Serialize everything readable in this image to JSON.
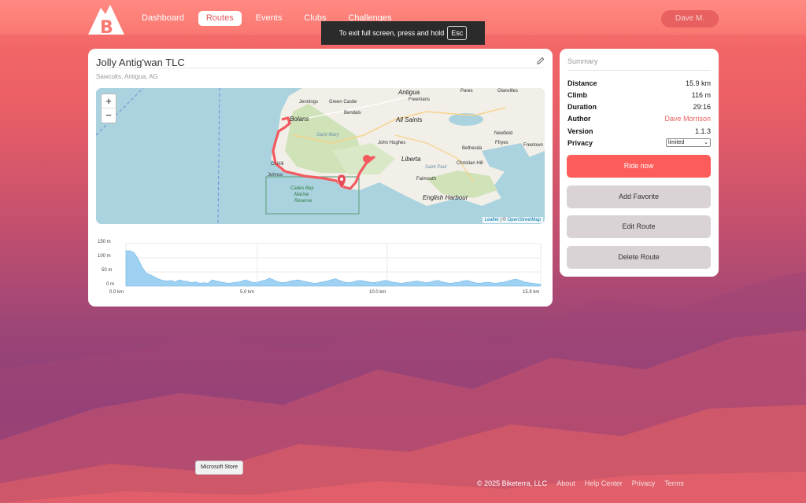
{
  "nav": {
    "items": [
      {
        "label": "Dashboard",
        "active": false
      },
      {
        "label": "Routes",
        "active": true
      },
      {
        "label": "Events",
        "active": false
      },
      {
        "label": "Clubs",
        "active": false
      },
      {
        "label": "Challenges",
        "active": false
      }
    ],
    "user": "Dave M."
  },
  "fullscreen_toast": {
    "text": "To exit full screen, press and hold",
    "key": "Esc"
  },
  "route": {
    "title": "Jolly Antig'wan TLC",
    "location": "Sawcolts, Antigua, AG",
    "edit_icon": "pencil-icon"
  },
  "map": {
    "zoom_in": "+",
    "zoom_out": "−",
    "labels": {
      "antigua": "Antigua",
      "all_saints": "All Saints",
      "liberta": "Liberta",
      "bolans": "Bolans",
      "jennings": "Jennings",
      "green_castle": "Green Castle",
      "bendals": "Bendals",
      "freemans": "Freemans",
      "parés": "Pares",
      "glanvilles": "Glanvilles",
      "newfield": "Newfield",
      "freetown": "Freetown",
      "ffryes": "Ffryes",
      "bethesda": "Bethesda",
      "christian_hill": "Christian Hill",
      "john_hughes": "John Hughes",
      "falmouth": "Falmouth",
      "english_harbour": "English Harbour",
      "saint_mary": "Saint Mary",
      "saint_paul": "Saint Paul",
      "cades_bay": "Cades Bay",
      "marine": "Marine",
      "reserve": "Reserve",
      "johnsons": "Johnso",
      "crab_hill": "Cr Hill"
    },
    "attribution": {
      "leaflet": "Leaflet",
      "sep": "| ©",
      "osm": "OpenStreetMap"
    }
  },
  "elevation": {
    "y_ticks": [
      "150 m",
      "100 m",
      "50 m",
      "0 m"
    ],
    "x_ticks": [
      "0.0 km",
      "5.0 km",
      "10.0 km",
      "15.9 km"
    ],
    "profile_m": [
      125,
      125,
      118,
      95,
      65,
      45,
      40,
      32,
      25,
      20,
      18,
      20,
      15,
      22,
      18,
      16,
      12,
      15,
      10,
      12,
      10,
      22,
      18,
      15,
      12,
      10,
      12,
      14,
      16,
      22,
      18,
      12,
      14,
      18,
      22,
      28,
      22,
      15,
      12,
      14,
      18,
      20,
      22,
      18,
      15,
      12,
      10,
      12,
      15,
      18,
      22,
      26,
      20,
      15,
      12,
      14,
      18,
      20,
      18,
      15,
      12,
      14,
      16,
      20,
      18,
      14,
      12,
      10,
      12,
      14,
      16,
      18,
      15,
      12,
      14,
      18,
      20,
      15,
      12,
      10,
      12,
      14,
      18,
      20,
      16,
      12,
      10,
      12,
      14,
      12,
      10,
      12,
      14,
      18,
      22,
      25,
      20,
      15,
      12,
      10,
      8,
      6
    ]
  },
  "summary": {
    "title": "Summary",
    "rows": [
      {
        "key": "Distance",
        "value": "15.9 km"
      },
      {
        "key": "Climb",
        "value": "116 m"
      },
      {
        "key": "Duration",
        "value": "29:16"
      },
      {
        "key": "Author",
        "value": "Dave Morrison"
      },
      {
        "key": "Version",
        "value": "1.1.3"
      },
      {
        "key": "Privacy",
        "value": "limited"
      }
    ],
    "buttons": {
      "ride": "Ride now",
      "favorite": "Add Favorite",
      "edit": "Edit Route",
      "delete": "Delete Route"
    }
  },
  "tooltip": "Microsoft Store",
  "footer": {
    "copyright": "© 2025 Biketerra, LLC",
    "links": [
      "About",
      "Help Center",
      "Privacy",
      "Terms"
    ]
  },
  "colors": {
    "accent": "#fc5d5b",
    "secondary": "#d9d3d5",
    "route_line": "#f25a5f"
  }
}
